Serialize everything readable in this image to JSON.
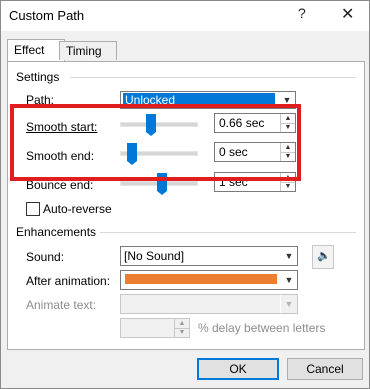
{
  "window": {
    "title": "Custom Path",
    "help_glyph": "?",
    "close_glyph": "✕"
  },
  "tabs": [
    {
      "label": "Effect"
    },
    {
      "label": "Timing"
    }
  ],
  "settings": {
    "group_label": "Settings",
    "path": {
      "label": "Path:",
      "value": "Unlocked"
    },
    "smooth_start": {
      "label": "Smooth start:",
      "value": "0.66 sec",
      "slider_fraction": 0.33
    },
    "smooth_end": {
      "label": "Smooth end:",
      "value": "0 sec",
      "slider_fraction": 0.0
    },
    "bounce_end": {
      "label": "Bounce end:",
      "value": "1 sec",
      "slider_fraction": 0.5
    },
    "auto_reverse": {
      "label": "Auto-reverse",
      "checked": false
    }
  },
  "enhancements": {
    "group_label": "Enhancements",
    "sound": {
      "label": "Sound:",
      "value": "[No Sound]"
    },
    "after_animation": {
      "label": "After animation:",
      "color": "#ed7d31"
    },
    "animate_text": {
      "label": "Animate text:",
      "value": ""
    },
    "delay": {
      "value": "",
      "suffix": "% delay between letters"
    }
  },
  "buttons": {
    "ok": "OK",
    "cancel": "Cancel"
  },
  "glyphs": {
    "combo_arrow": "▼",
    "spin_up": "▲",
    "spin_down": "▼",
    "speaker_icon": "🔈"
  }
}
